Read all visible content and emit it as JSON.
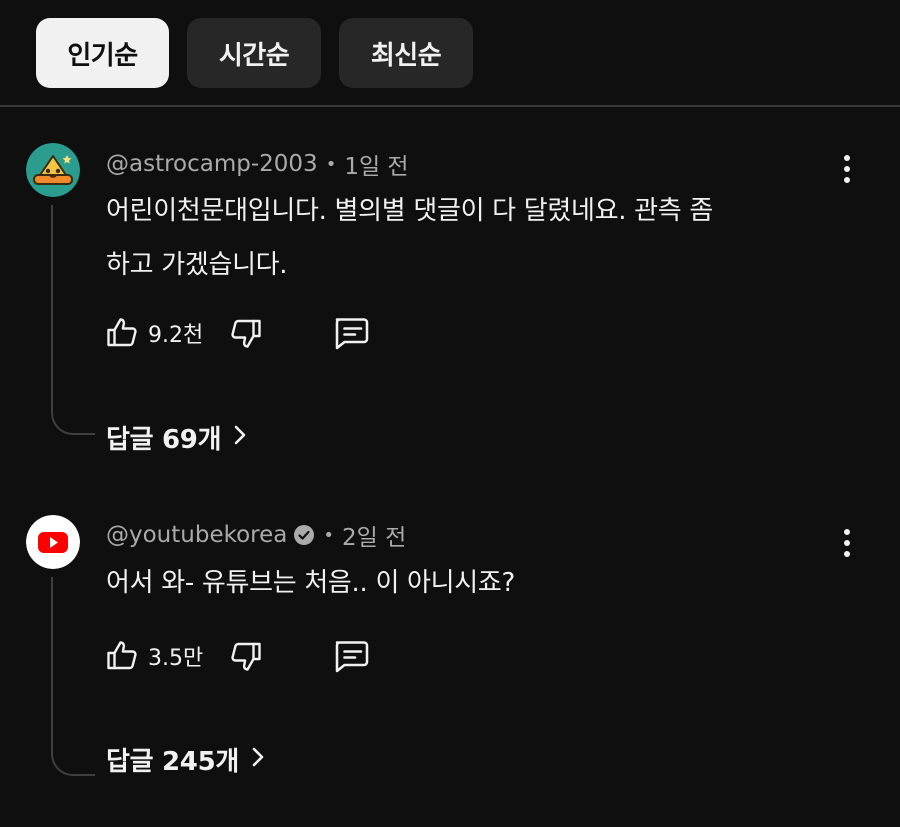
{
  "sort_chips": [
    {
      "label": "인기순",
      "active": true
    },
    {
      "label": "시간순",
      "active": false
    },
    {
      "label": "최신순",
      "active": false
    }
  ],
  "comments": [
    {
      "author": "@astrocamp-2003",
      "verified": false,
      "time": "1일 전",
      "text_lines": [
        "어린이천문대입니다. 별의별 댓글이 다 달렸네요. 관측 좀",
        "하고 가겠습니다."
      ],
      "likes": "9.2천",
      "replies_label": "답글 69개",
      "avatar_icon": "astro-mascot-icon",
      "avatar_bg": "#2a9d8f"
    },
    {
      "author": "@youtubekorea",
      "verified": true,
      "time": "2일 전",
      "text_lines": [
        "어서 와- 유튜브는 처음.. 이 아니시죠?"
      ],
      "likes": "3.5만",
      "replies_label": "답글 245개",
      "avatar_icon": "youtube-logo-icon",
      "avatar_bg": "#ffffff"
    }
  ],
  "colors": {
    "background": "#0f0f0f",
    "chip_active_bg": "#f1f1f1",
    "chip_inactive_bg": "#272727",
    "secondary_text": "#aaaaaa",
    "youtube_red": "#ff0000"
  }
}
